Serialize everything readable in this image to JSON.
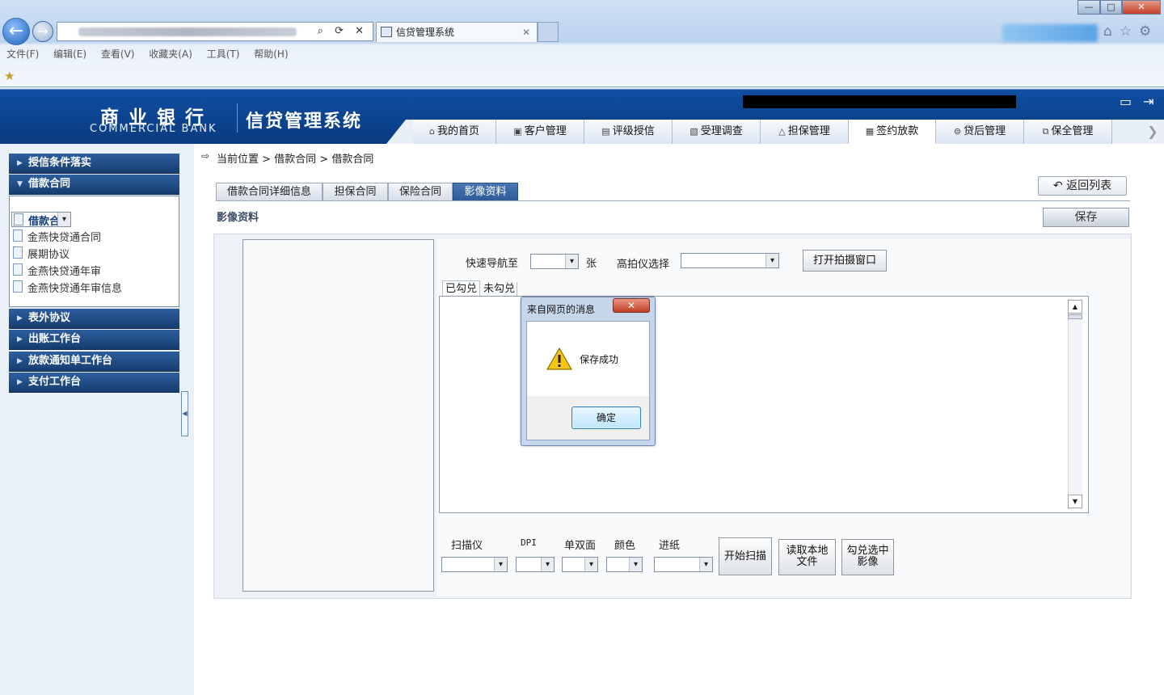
{
  "browser": {
    "tab_title": "信贷管理系统",
    "menu": [
      "文件(F)",
      "编辑(E)",
      "查看(V)",
      "收藏夹(A)",
      "工具(T)",
      "帮助(H)"
    ],
    "controls": {
      "minimize": "—",
      "maximize": "□",
      "close": "✕"
    }
  },
  "header": {
    "bank_name_cn": "商业银行",
    "bank_name_en": "COMMERCIAL BANK",
    "system_name": "信贷管理系统",
    "nav_tabs": [
      {
        "label": "我的首页",
        "icon": "home-icon"
      },
      {
        "label": "客户管理",
        "icon": "customer-icon"
      },
      {
        "label": "评级授信",
        "icon": "rating-icon"
      },
      {
        "label": "受理调查",
        "icon": "survey-icon"
      },
      {
        "label": "担保管理",
        "icon": "guarantee-icon"
      },
      {
        "label": "签约放款",
        "icon": "contract-icon",
        "active": true
      },
      {
        "label": "贷后管理",
        "icon": "postloan-icon"
      },
      {
        "label": "保全管理",
        "icon": "preservation-icon"
      }
    ]
  },
  "sidebar": {
    "sections": [
      {
        "label": "授信条件落实",
        "expanded": false
      },
      {
        "label": "借款合同",
        "expanded": true
      },
      {
        "label": "表外协议",
        "expanded": false
      },
      {
        "label": "出账工作台",
        "expanded": false
      },
      {
        "label": "放款通知单工作台",
        "expanded": false
      },
      {
        "label": "支付工作台",
        "expanded": false
      }
    ],
    "items": [
      "借款合同",
      "金燕快贷通合同",
      "展期协议",
      "金燕快贷通年审",
      "金燕快贷通年审信息"
    ]
  },
  "breadcrumb": "当前位置 > 借款合同 > 借款合同",
  "content_tabs": [
    "借款合同详细信息",
    "担保合同",
    "保险合同",
    "影像资料"
  ],
  "active_content_tab": "影像资料",
  "back_button": "返回列表",
  "section_title": "影像资料",
  "save_button": "保存",
  "image_panel": {
    "quick_nav_label": "快速导航至",
    "unit": "张",
    "camera_label": "高拍仪选择",
    "open_camera_button": "打开拍摄窗口",
    "subtabs": [
      "已勾兑",
      "未勾兑"
    ],
    "scan": {
      "scanner": "扫描仪",
      "dpi": "DPI",
      "duplex": "单双面",
      "color": "颜色",
      "feed": "进纸",
      "start_button": "开始扫描",
      "read_local_button": [
        "读取本地",
        "文件"
      ],
      "check_selected_button": [
        "勾兑选中",
        "影像"
      ]
    }
  },
  "dialog": {
    "title": "来自网页的消息",
    "message": "保存成功",
    "ok": "确定",
    "close": "✕"
  }
}
